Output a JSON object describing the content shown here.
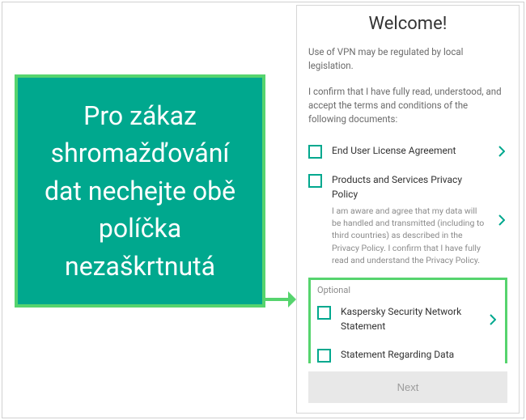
{
  "callout": {
    "text": "Pro zákaz shromažďování dat nechejte obě políčka nezaškrtnutá"
  },
  "colors": {
    "accent": "#00a88e",
    "highlight": "#56d46e"
  },
  "screen": {
    "title": "Welcome!",
    "intro1": "Use of VPN may be regulated by local legislation.",
    "intro2": "I confirm that I have fully read, understood, and accept the terms and conditions of the following documents:",
    "docs": [
      {
        "label": "End User License Agreement",
        "sub": ""
      },
      {
        "label": "Products and Services Privacy Policy",
        "sub": "I am aware and agree that my data will be handled and transmitted (including to third countries) as described in the Privacy Policy. I confirm that I have fully read and understand the Privacy Policy."
      }
    ],
    "optional_heading": "Optional",
    "optional_docs": [
      {
        "label": "Kaspersky Security Network Statement"
      },
      {
        "label": "Statement Regarding Data Processing for Marketing Purposes"
      }
    ],
    "next_label": "Next"
  }
}
